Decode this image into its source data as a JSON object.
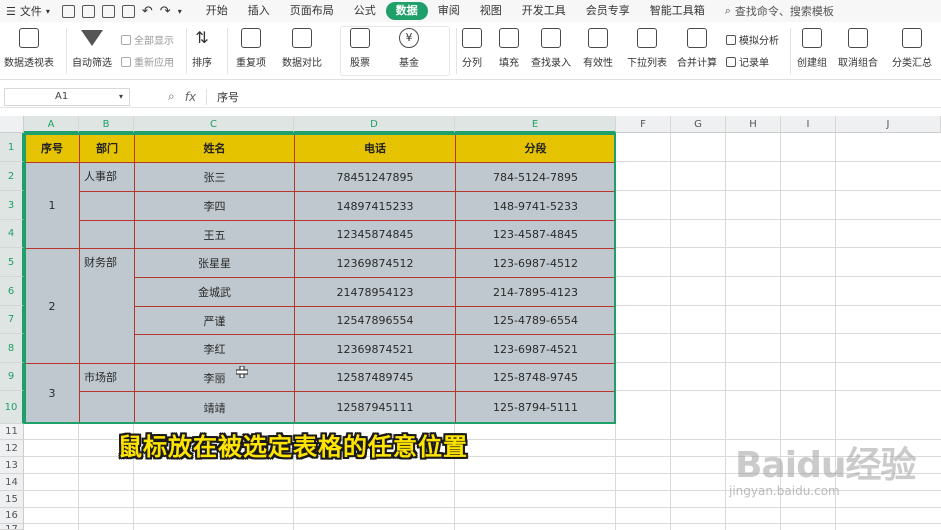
{
  "menubar": {
    "file_label": "文件",
    "tabs": [
      "开始",
      "插入",
      "页面布局",
      "公式",
      "数据",
      "审阅",
      "视图",
      "开发工具",
      "会员专享",
      "智能工具箱"
    ],
    "active_tab": "数据",
    "search_label": "查找命令、搜索模板"
  },
  "ribbon": {
    "pivot_label": "数据透视表",
    "autofilter_label": "自动筛选",
    "show_all_label": "全部显示",
    "reapply_label": "重新应用",
    "sort_label": "排序",
    "duplicates_label": "重复项",
    "compare_label": "数据对比",
    "stock_label": "股票",
    "fund_label": "基金",
    "split_label": "分列",
    "fill_label": "填充",
    "lookup_entry_label": "查找录入",
    "validity_label": "有效性",
    "dropdown_list_label": "下拉列表",
    "consolidate_label": "合并计算",
    "simulation_label": "模拟分析",
    "record_label": "记录单",
    "group_label": "创建组",
    "ungroup_label": "取消组合",
    "subtotal_label": "分类汇总"
  },
  "formula_bar": {
    "name_box": "A1",
    "fx_label": "fx",
    "content": "序号"
  },
  "sheet": {
    "columns": [
      "A",
      "B",
      "C",
      "D",
      "E",
      "F",
      "G",
      "H",
      "I",
      "J"
    ],
    "rows": [
      "1",
      "2",
      "3",
      "4",
      "5",
      "6",
      "7",
      "8",
      "9",
      "10",
      "11",
      "12",
      "13",
      "14",
      "15",
      "16",
      "17"
    ],
    "headers": [
      "序号",
      "部门",
      "姓名",
      "电话",
      "分段"
    ],
    "merged": {
      "a_top": "1",
      "a_mid": "2",
      "a_bot": "3"
    },
    "departments": [
      "人事部",
      "",
      "",
      "财务部",
      "",
      "",
      "",
      "市场部",
      ""
    ],
    "names": [
      "张三",
      "李四",
      "王五",
      "张星星",
      "金城武",
      "严谨",
      "李红",
      "李丽",
      "靖靖"
    ],
    "phones": [
      "78451247895",
      "14897415233",
      "12345874845",
      "12369874512",
      "21478954123",
      "12547896554",
      "12369874521",
      "12587489745",
      "12587945111"
    ],
    "segments": [
      "784-5124-7895",
      "148-9741-5233",
      "123-4587-4845",
      "123-6987-4512",
      "214-7895-4123",
      "125-4789-6554",
      "123-6987-4521",
      "125-8748-9745",
      "125-8794-5111"
    ]
  },
  "caption": "鼠标放在被选定表格的任意位置",
  "watermark": {
    "brand": "Baidu经验",
    "url": "jingyan.baidu.com"
  },
  "colors": {
    "accent": "#1f9f69",
    "header_fill": "#e6c300",
    "data_fill": "#bfc8cf",
    "border_red": "#b5362a",
    "caption_yellow": "#ffe400"
  }
}
